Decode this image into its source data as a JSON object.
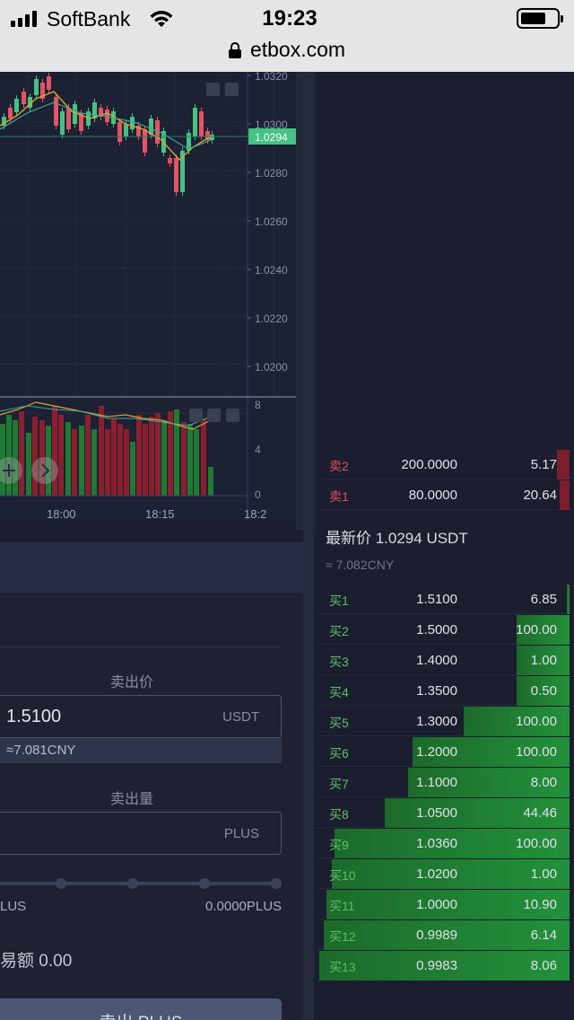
{
  "status": {
    "carrier": "SoftBank",
    "time": "19:23",
    "url": "etbox.com",
    "battery_level": 0.7
  },
  "chart": {
    "price_ticks": [
      "1.0320",
      "1.0300",
      "1.0280",
      "1.0260",
      "1.0240",
      "1.0220",
      "1.0200"
    ],
    "current_price": "1.0294",
    "volume_ticks": [
      "8",
      "4",
      "0"
    ],
    "time_ticks": [
      "18:00",
      "18:15",
      "18:2"
    ],
    "up_color": "#45c284",
    "down_color": "#e35466"
  },
  "form": {
    "price_label": "卖出价",
    "price_value": "1.5100",
    "price_unit": "USDT",
    "cny_hint": "≈7.081CNY",
    "amount_label": "卖出量",
    "amount_unit": "PLUS",
    "available_left": "LUS",
    "available_right": "0.0000PLUS",
    "total_text": "易额 0.00",
    "sell_button": "卖出 PLUS"
  },
  "orderbook": {
    "asks": [
      {
        "name": "卖2",
        "price": "200.0000",
        "amount": "5.17",
        "fill": 0.05
      },
      {
        "name": "卖1",
        "price": "80.0000",
        "amount": "20.64",
        "fill": 0.04
      }
    ],
    "last_price": "最新价 1.0294 USDT",
    "cny": "≈ 7.082CNY",
    "bids": [
      {
        "name": "买1",
        "price": "1.5100",
        "amount": "6.85",
        "fill": 0.01
      },
      {
        "name": "买2",
        "price": "1.5000",
        "amount": "100.00",
        "fill": 0.21
      },
      {
        "name": "买3",
        "price": "1.4000",
        "amount": "1.00",
        "fill": 0.21
      },
      {
        "name": "买4",
        "price": "1.3500",
        "amount": "0.50",
        "fill": 0.21
      },
      {
        "name": "买5",
        "price": "1.3000",
        "amount": "100.00",
        "fill": 0.42
      },
      {
        "name": "买6",
        "price": "1.2000",
        "amount": "100.00",
        "fill": 0.62
      },
      {
        "name": "买7",
        "price": "1.1000",
        "amount": "8.00",
        "fill": 0.64
      },
      {
        "name": "买8",
        "price": "1.0500",
        "amount": "44.46",
        "fill": 0.73
      },
      {
        "name": "买9",
        "price": "1.0360",
        "amount": "100.00",
        "fill": 0.93
      },
      {
        "name": "买10",
        "price": "1.0200",
        "amount": "1.00",
        "fill": 0.94
      },
      {
        "name": "买11",
        "price": "1.0000",
        "amount": "10.90",
        "fill": 0.96
      },
      {
        "name": "买12",
        "price": "0.9989",
        "amount": "6.14",
        "fill": 0.97
      },
      {
        "name": "买13",
        "price": "0.9983",
        "amount": "8.06",
        "fill": 0.99
      }
    ]
  }
}
